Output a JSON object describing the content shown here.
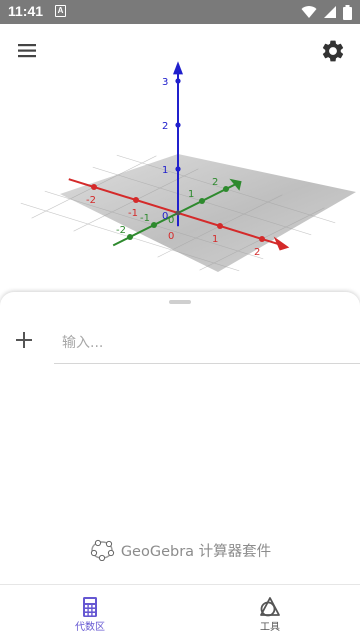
{
  "status_bar": {
    "time": "11:41",
    "notification_glyph": "A"
  },
  "toolbar": {
    "menu_icon": "hamburger-menu-icon",
    "settings_icon": "gear-icon"
  },
  "graphics_3d": {
    "z_ticks": [
      "1",
      "2",
      "3"
    ],
    "x_ticks": [
      "-2",
      "-1",
      "1",
      "2"
    ],
    "y_ticks": [
      "-2",
      "-1",
      "1",
      "2"
    ],
    "origin_labels": [
      "0",
      "0",
      "0"
    ],
    "axis_colors": {
      "x": "#d42a2a",
      "y": "#2e8a2e",
      "z": "#2020cc"
    }
  },
  "algebra": {
    "input_placeholder": "输入...",
    "input_value": "",
    "brand_label": "GeoGebra 计算器套件"
  },
  "bottom_nav": {
    "tabs": [
      {
        "label": "代数区",
        "icon": "calculator-icon",
        "active": true
      },
      {
        "label": "工具",
        "icon": "geometry-tools-icon",
        "active": false
      }
    ]
  },
  "colors": {
    "accent": "#6557d2",
    "status_bar": "#7a7a7a"
  }
}
